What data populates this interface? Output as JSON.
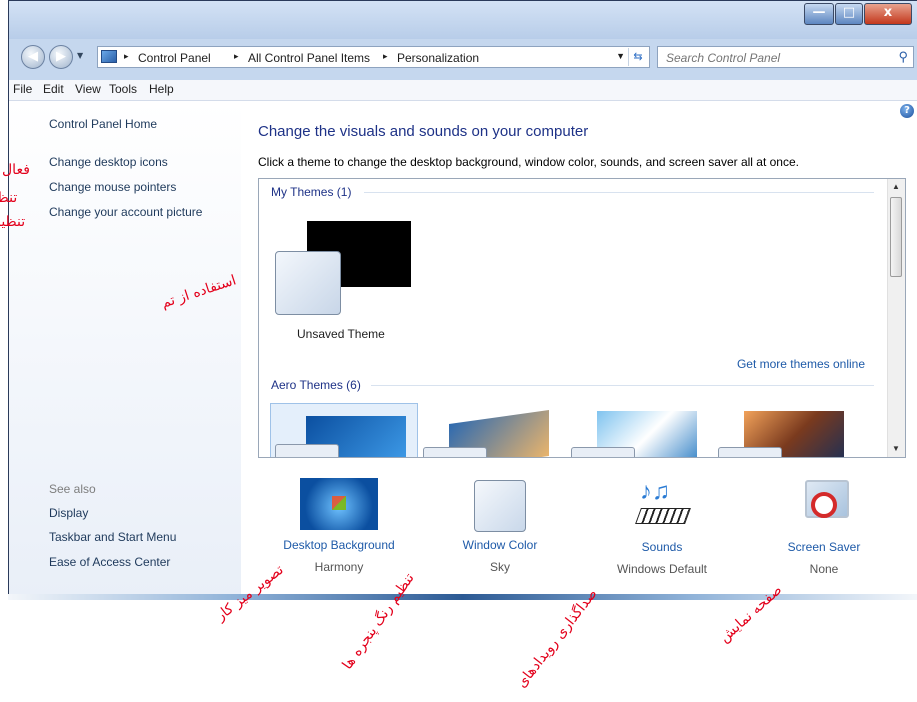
{
  "window": {
    "controls": {
      "minimize": "—",
      "maximize": "□",
      "close": "x"
    }
  },
  "address_bar": {
    "crumbs": [
      "Control Panel",
      "All Control Panel Items",
      "Personalization"
    ],
    "separator": "▸"
  },
  "search": {
    "placeholder": "Search Control Panel"
  },
  "menu": [
    "File",
    "Edit",
    "View",
    "Tools",
    "Help"
  ],
  "left_pane": {
    "home": "Control Panel Home",
    "tasks": [
      "Change desktop icons",
      "Change mouse pointers",
      "Change your account picture"
    ],
    "see_also_header": "See also",
    "see_also": [
      "Display",
      "Taskbar and Start Menu",
      "Ease of Access Center"
    ]
  },
  "main": {
    "heading": "Change the visuals and sounds on your computer",
    "description": "Click a theme to change the desktop background, window color, sounds, and screen saver all at once.",
    "my_themes_header": "My Themes (1)",
    "unsaved_theme": "Unsaved Theme",
    "more_themes_link": "Get more themes online",
    "aero_themes_header": "Aero Themes (6)"
  },
  "bottom": [
    {
      "title": "Desktop Background",
      "subtitle": "Harmony",
      "icon": "desktop-background-icon"
    },
    {
      "title": "Window Color",
      "subtitle": "Sky",
      "icon": "window-color-icon"
    },
    {
      "title": "Sounds",
      "subtitle": "Windows Default",
      "icon": "sounds-icon"
    },
    {
      "title": "Screen Saver",
      "subtitle": "None",
      "icon": "screen-saver-icon"
    }
  ],
  "annotations": {
    "left_1": "فعال",
    "left_2": "تنظی",
    "left_3": "تنظیم",
    "theme_use": "استفاده از تم",
    "bg": "تصویر میز کار",
    "color": "تنظیم رنگ پنجره ها",
    "sounds": "صداگذاری رویدادهای",
    "saver": "صفحه نمایش"
  },
  "colors": {
    "link": "#1e395b",
    "heading": "#1e3287",
    "annotation": "#e3001b"
  }
}
